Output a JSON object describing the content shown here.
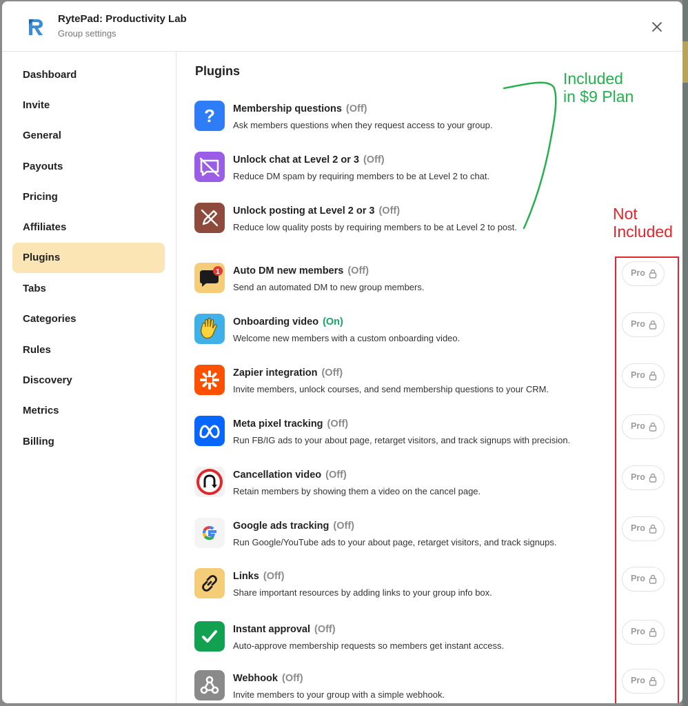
{
  "app": {
    "title": "RytePad: Productivity Lab",
    "subtitle": "Group settings",
    "logo_letter": "R"
  },
  "sidebar": {
    "items": [
      {
        "label": "Dashboard",
        "active": false
      },
      {
        "label": "Invite",
        "active": false
      },
      {
        "label": "General",
        "active": false
      },
      {
        "label": "Payouts",
        "active": false
      },
      {
        "label": "Pricing",
        "active": false
      },
      {
        "label": "Affiliates",
        "active": false
      },
      {
        "label": "Plugins",
        "active": true
      },
      {
        "label": "Tabs",
        "active": false
      },
      {
        "label": "Categories",
        "active": false
      },
      {
        "label": "Rules",
        "active": false
      },
      {
        "label": "Discovery",
        "active": false
      },
      {
        "label": "Metrics",
        "active": false
      },
      {
        "label": "Billing",
        "active": false
      }
    ]
  },
  "main": {
    "title": "Plugins",
    "plugins": [
      {
        "name": "Membership questions",
        "status": "(Off)",
        "desc": "Ask members questions when they request access to your group.",
        "icon": "question-mark-icon",
        "locked": false
      },
      {
        "name": "Unlock chat at Level 2 or 3",
        "status": "(Off)",
        "desc": "Reduce DM spam by requiring members to be at Level 2 to chat.",
        "icon": "chat-off-icon",
        "locked": false
      },
      {
        "name": "Unlock posting at Level 2 or 3",
        "status": "(Off)",
        "desc": "Reduce low quality posts by requiring members to be at Level 2 to post.",
        "icon": "pencil-off-icon",
        "locked": false
      },
      {
        "name": "Auto DM new members",
        "status": "(Off)",
        "desc": "Send an automated DM to new group members.",
        "icon": "speech-bubble-icon",
        "badge": "1",
        "locked": true
      },
      {
        "name": "Onboarding video",
        "status": "(On)",
        "desc": "Welcome new members with a custom onboarding video.",
        "icon": "waving-hand-icon",
        "locked": true
      },
      {
        "name": "Zapier integration",
        "status": "(Off)",
        "desc": "Invite members, unlock courses, and send membership questions to your CRM.",
        "icon": "zapier-icon",
        "locked": true
      },
      {
        "name": "Meta pixel tracking",
        "status": "(Off)",
        "desc": "Run FB/IG ads to your about page, retarget visitors, and track signups with precision.",
        "icon": "meta-icon",
        "locked": true
      },
      {
        "name": "Cancellation video",
        "status": "(Off)",
        "desc": "Retain members by showing them a video on the cancel page.",
        "icon": "u-turn-icon",
        "locked": true
      },
      {
        "name": "Google ads tracking",
        "status": "(Off)",
        "desc": "Run Google/YouTube ads to your about page, retarget visitors, and track signups.",
        "icon": "google-icon",
        "locked": true
      },
      {
        "name": "Links",
        "status": "(Off)",
        "desc": "Share important resources by adding links to your group info box.",
        "icon": "link-icon",
        "locked": true
      },
      {
        "name": "Instant approval",
        "status": "(Off)",
        "desc": "Auto-approve membership requests so members get instant access.",
        "icon": "checkmark-icon",
        "locked": true
      },
      {
        "name": "Webhook",
        "status": "(Off)",
        "desc": "Invite members to your group with a simple webhook.",
        "icon": "webhook-icon",
        "locked": true
      }
    ],
    "pro_label": "Pro"
  },
  "annotations": {
    "included_line1": "Included",
    "included_line2": "in $9 Plan",
    "not_included_line1": "Not",
    "not_included_line2": "Included"
  },
  "colors": {
    "status_on": "#17a463",
    "status_off": "#8a8a8a",
    "active_nav": "#fbe5b5",
    "annotation_green": "#22b14c",
    "annotation_red": "#e0262b"
  }
}
